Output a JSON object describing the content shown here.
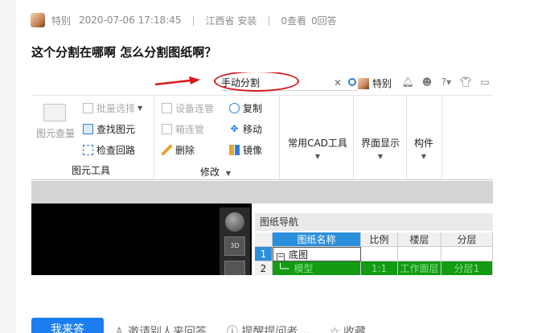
{
  "question": {
    "author": "特别",
    "datetime": "2020-07-06 17:18:45",
    "location": "江西省 安装",
    "views": "0查看",
    "answers": "0回答",
    "title": "这个分割在哪啊 怎么分割图纸啊？"
  },
  "screenshot": {
    "search_value": "手动分割",
    "user": "特别",
    "ribbon": {
      "batch_select": "批量选择",
      "find_element": "查找图元",
      "check_loop": "检查回路",
      "element_view": "图元查量",
      "group_element_tools": "图元工具",
      "device_pipe": "设备连管",
      "box_pipe": "箱连管",
      "delete": "删除",
      "copy": "复制",
      "move": "移动",
      "mirror": "镜像",
      "group_modify": "修改",
      "common_cad_tools": "常用CAD工具",
      "ui_display": "界面显示",
      "component": "构件"
    },
    "drawing_nav": {
      "title": "图纸导航",
      "columns": [
        "图纸名称",
        "比例",
        "楼层",
        "分层"
      ],
      "rows": [
        {
          "num": "1",
          "name": "底图",
          "scale": "",
          "floor": "",
          "layer": ""
        },
        {
          "num": "2",
          "name": "模型",
          "scale": "1:1",
          "floor": "工作面层",
          "layer": "分层1"
        }
      ]
    },
    "cube_labels": {
      "view3d": "3D"
    }
  },
  "actions": {
    "answer": "我来答",
    "invite": "邀请别人来回答",
    "remind": "提醒提问者",
    "collect": "收藏"
  },
  "colors": {
    "accent": "#1a7ef0",
    "annotation_red": "#d9181e",
    "selected_header": "#2b8fdc",
    "model_row_green": "#139b13"
  }
}
